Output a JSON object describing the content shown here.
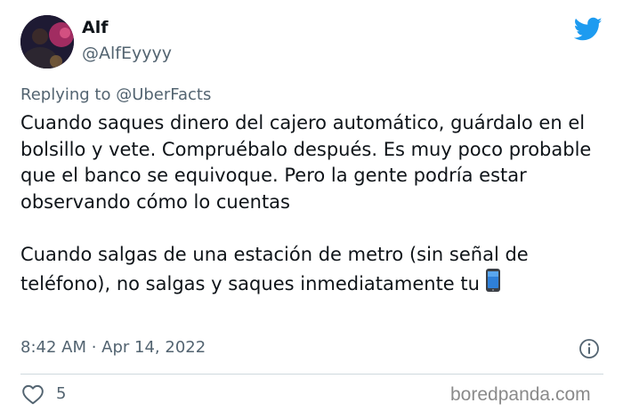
{
  "tweet": {
    "display_name": "Alf",
    "handle": "@AlfEyyyy",
    "replying_to": "Replying to @UberFacts",
    "paragraph1": "Cuando saques dinero del cajero automático, guárdalo en el bolsillo y vete. Compruébalo después. Es muy poco probable que el banco se equivoque. Pero la gente podría estar observando cómo lo cuentas",
    "paragraph2": "Cuando salgas de una estación de metro (sin señal de teléfono), no salgas y saques inmediatamente tu",
    "emoji": "mobile-phone-icon",
    "timestamp": "8:42 AM · Apr 14, 2022",
    "likes": "5"
  },
  "icons": {
    "platform": "twitter-bird-icon",
    "info": "info-icon",
    "like": "heart-icon"
  },
  "colors": {
    "twitter_blue": "#1d9bf0",
    "secondary_text": "#536471",
    "primary_text": "#0f1419"
  },
  "watermark": "boredpanda.com"
}
